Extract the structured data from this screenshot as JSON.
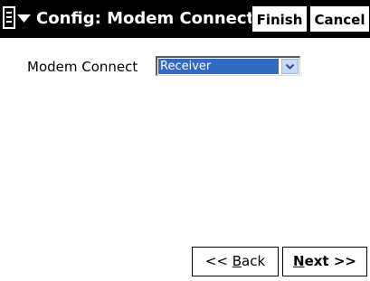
{
  "titlebar": {
    "title": "Config: Modem Connect",
    "finish_label": "Finish",
    "cancel_label": "Cancel",
    "menu_icon": "start-menu-icon"
  },
  "form": {
    "modem_connect_label": "Modem Connect",
    "modem_connect_value": "Receiver"
  },
  "nav": {
    "back_prefix": "<< ",
    "back_accel": "B",
    "back_rest": "ack",
    "next_accel": "N",
    "next_rest": "ext >>"
  },
  "colors": {
    "titlebar_bg": "#000000",
    "selection_bg": "#316ac5",
    "dropdown_arrow_bg": "#c7d8f8"
  }
}
